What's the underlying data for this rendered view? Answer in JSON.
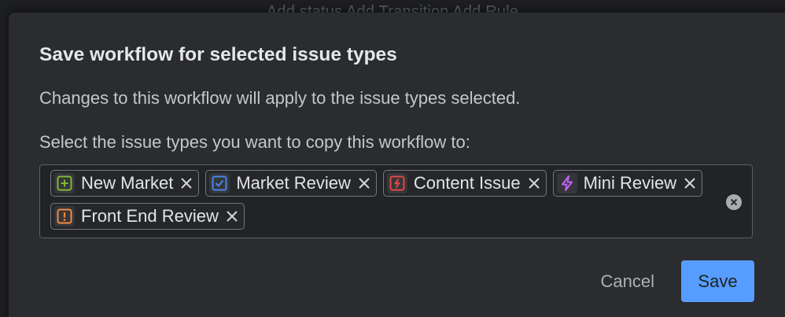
{
  "backdrop": {
    "toolbar_text": "Add status   Add Transition   Add Rule"
  },
  "dialog": {
    "title": "Save workflow for selected issue types",
    "description": "Changes to this workflow will apply to the issue types selected.",
    "field_label": "Select the issue types you want to copy this workflow to:",
    "selected_issue_types": [
      {
        "label": "New Market",
        "icon": "plus-square-icon",
        "color": "#82b536"
      },
      {
        "label": "Market Review",
        "icon": "checkbox-icon",
        "color": "#4688ec"
      },
      {
        "label": "Content Issue",
        "icon": "lightning-box-icon",
        "color": "#e2483d"
      },
      {
        "label": "Mini Review",
        "icon": "lightning-icon",
        "color": "#bf63f3"
      },
      {
        "label": "Front End Review",
        "icon": "exclamation-box-icon",
        "color": "#f38a3f"
      }
    ],
    "cancel_label": "Cancel",
    "save_label": "Save"
  },
  "colors": {
    "primary_button": "#579dff",
    "dialog_background": "#2b2c30"
  }
}
